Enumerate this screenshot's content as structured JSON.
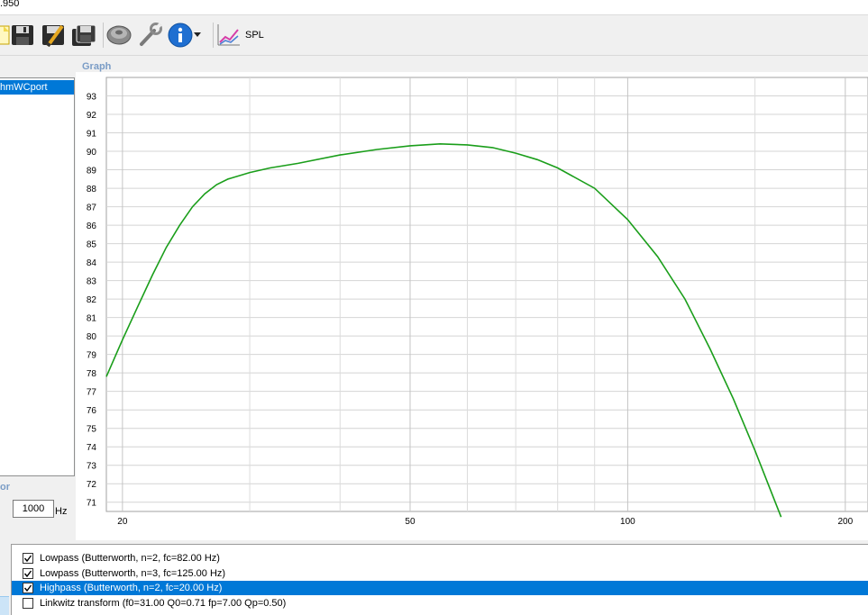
{
  "window": {
    "title_fragment": ".950"
  },
  "toolbar": {
    "buttons": [
      {
        "name": "new-file-icon"
      },
      {
        "name": "save-icon"
      },
      {
        "name": "save-edit-icon"
      },
      {
        "name": "save-all-icon"
      },
      {
        "name": "speaker-icon"
      },
      {
        "name": "wrench-icon"
      },
      {
        "name": "info-icon"
      },
      {
        "name": "dropdown-arrow-icon"
      },
      {
        "name": "spl-chart-icon"
      }
    ],
    "spl_label": "SPL"
  },
  "project_list": {
    "selected_item": "hmWCport"
  },
  "graph_section": {
    "label": "Graph"
  },
  "frequency_section": {
    "label": "or",
    "value": "1000",
    "unit": "Hz"
  },
  "chart_data": {
    "type": "line",
    "title": "",
    "xlabel": "",
    "ylabel": "",
    "xscale": "log",
    "xlim": [
      19,
      215
    ],
    "ylim": [
      70.5,
      94
    ],
    "x_ticks": [
      "20",
      "50",
      "100",
      "200"
    ],
    "y_ticks": [
      "93",
      "92",
      "91",
      "90",
      "89",
      "88",
      "87",
      "86",
      "85",
      "84",
      "83",
      "82",
      "81",
      "80",
      "79",
      "78",
      "77",
      "76",
      "75",
      "74",
      "73",
      "72",
      "71"
    ],
    "grid": true,
    "series": [
      {
        "color": "#1a9e1a",
        "points": [
          [
            19,
            77.8
          ],
          [
            20,
            79.8
          ],
          [
            21,
            81.6
          ],
          [
            22,
            83.3
          ],
          [
            23,
            84.8
          ],
          [
            24,
            86.0
          ],
          [
            25,
            87.0
          ],
          [
            26,
            87.7
          ],
          [
            27,
            88.2
          ],
          [
            28,
            88.5
          ],
          [
            30,
            88.85
          ],
          [
            32,
            89.1
          ],
          [
            35,
            89.35
          ],
          [
            40,
            89.8
          ],
          [
            45,
            90.1
          ],
          [
            50,
            90.3
          ],
          [
            55,
            90.4
          ],
          [
            60,
            90.35
          ],
          [
            65,
            90.2
          ],
          [
            70,
            89.9
          ],
          [
            75,
            89.55
          ],
          [
            80,
            89.1
          ],
          [
            90,
            88.0
          ],
          [
            100,
            86.3
          ],
          [
            110,
            84.3
          ],
          [
            120,
            82.0
          ],
          [
            130,
            79.3
          ],
          [
            140,
            76.6
          ],
          [
            150,
            73.8
          ],
          [
            160,
            71.0
          ],
          [
            163,
            70.2
          ]
        ]
      }
    ]
  },
  "filters": [
    {
      "checked": true,
      "label": "Lowpass (Butterworth, n=2, fc=82.00 Hz)",
      "selected": false
    },
    {
      "checked": true,
      "label": "Lowpass (Butterworth, n=3, fc=125.00 Hz)",
      "selected": false
    },
    {
      "checked": true,
      "label": "Highpass (Butterworth, n=2, fc=20.00 Hz)",
      "selected": true
    },
    {
      "checked": false,
      "label": "Linkwitz transform (f0=31.00 Q0=0.71 fp=7.00 Qp=0.50)",
      "selected": false
    }
  ]
}
